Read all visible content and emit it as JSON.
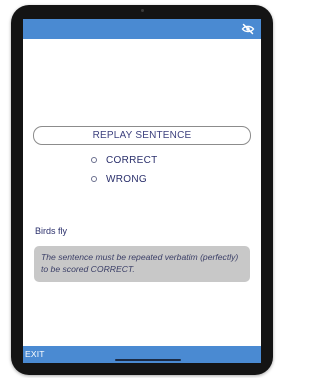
{
  "header": {
    "visibility_icon": "eye-slash-icon"
  },
  "main": {
    "replay_label": "REPLAY SENTENCE",
    "options": [
      "CORRECT",
      "WRONG"
    ],
    "sentence": "Birds fly",
    "instruction": "The sentence must be repeated verbatim (perfectly) to be scored CORRECT."
  },
  "footer": {
    "exit_label": "EXIT"
  },
  "colors": {
    "bar_blue": "#4a8ad2",
    "text_navy": "#2a2f6b",
    "note_gray": "#c8c8c8"
  }
}
